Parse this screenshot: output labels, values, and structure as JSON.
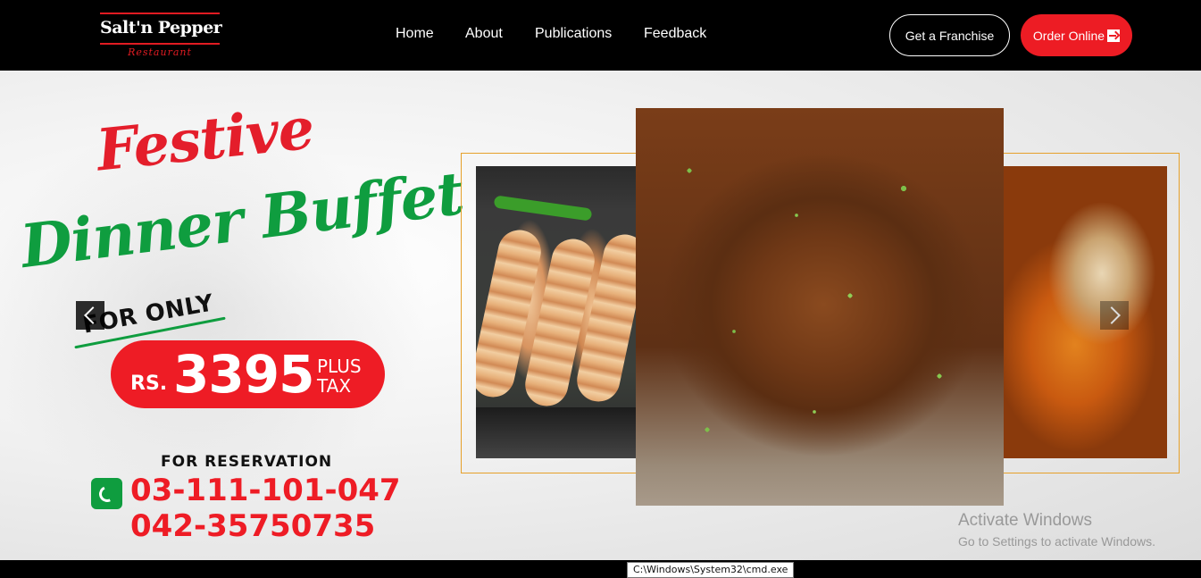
{
  "header": {
    "logo": {
      "main": "Salt'n Pepper",
      "sub": "Restaurant"
    },
    "nav": [
      {
        "label": "Home"
      },
      {
        "label": "About"
      },
      {
        "label": "Publications"
      },
      {
        "label": "Feedback"
      }
    ],
    "franchise_label": "Get a Franchise",
    "order_label": "Order Online"
  },
  "hero": {
    "headline_1": "Festive",
    "headline_2": "Dinner Buffet",
    "for_only": "FOR ONLY",
    "price_currency": "RS.",
    "price_value": "3395",
    "price_plus": "PLUS",
    "price_tax": "TAX",
    "reservation_label": "FOR RESERVATION",
    "phones": [
      "03-111-101-047",
      "042-35750735"
    ]
  },
  "carousel": {
    "slides": [
      "seekh-kebab",
      "mutton-karahi",
      "nihari"
    ],
    "accent_color": "#e6a02a"
  },
  "watermark": {
    "title": "Activate Windows",
    "subtitle": "Go to Settings to activate Windows."
  },
  "taskbar": {
    "tooltip": "C:\\Windows\\System32\\cmd.exe"
  },
  "colors": {
    "brand_red": "#ed1c24",
    "brand_green": "#0f9d3f",
    "nav_bg": "#000000"
  }
}
